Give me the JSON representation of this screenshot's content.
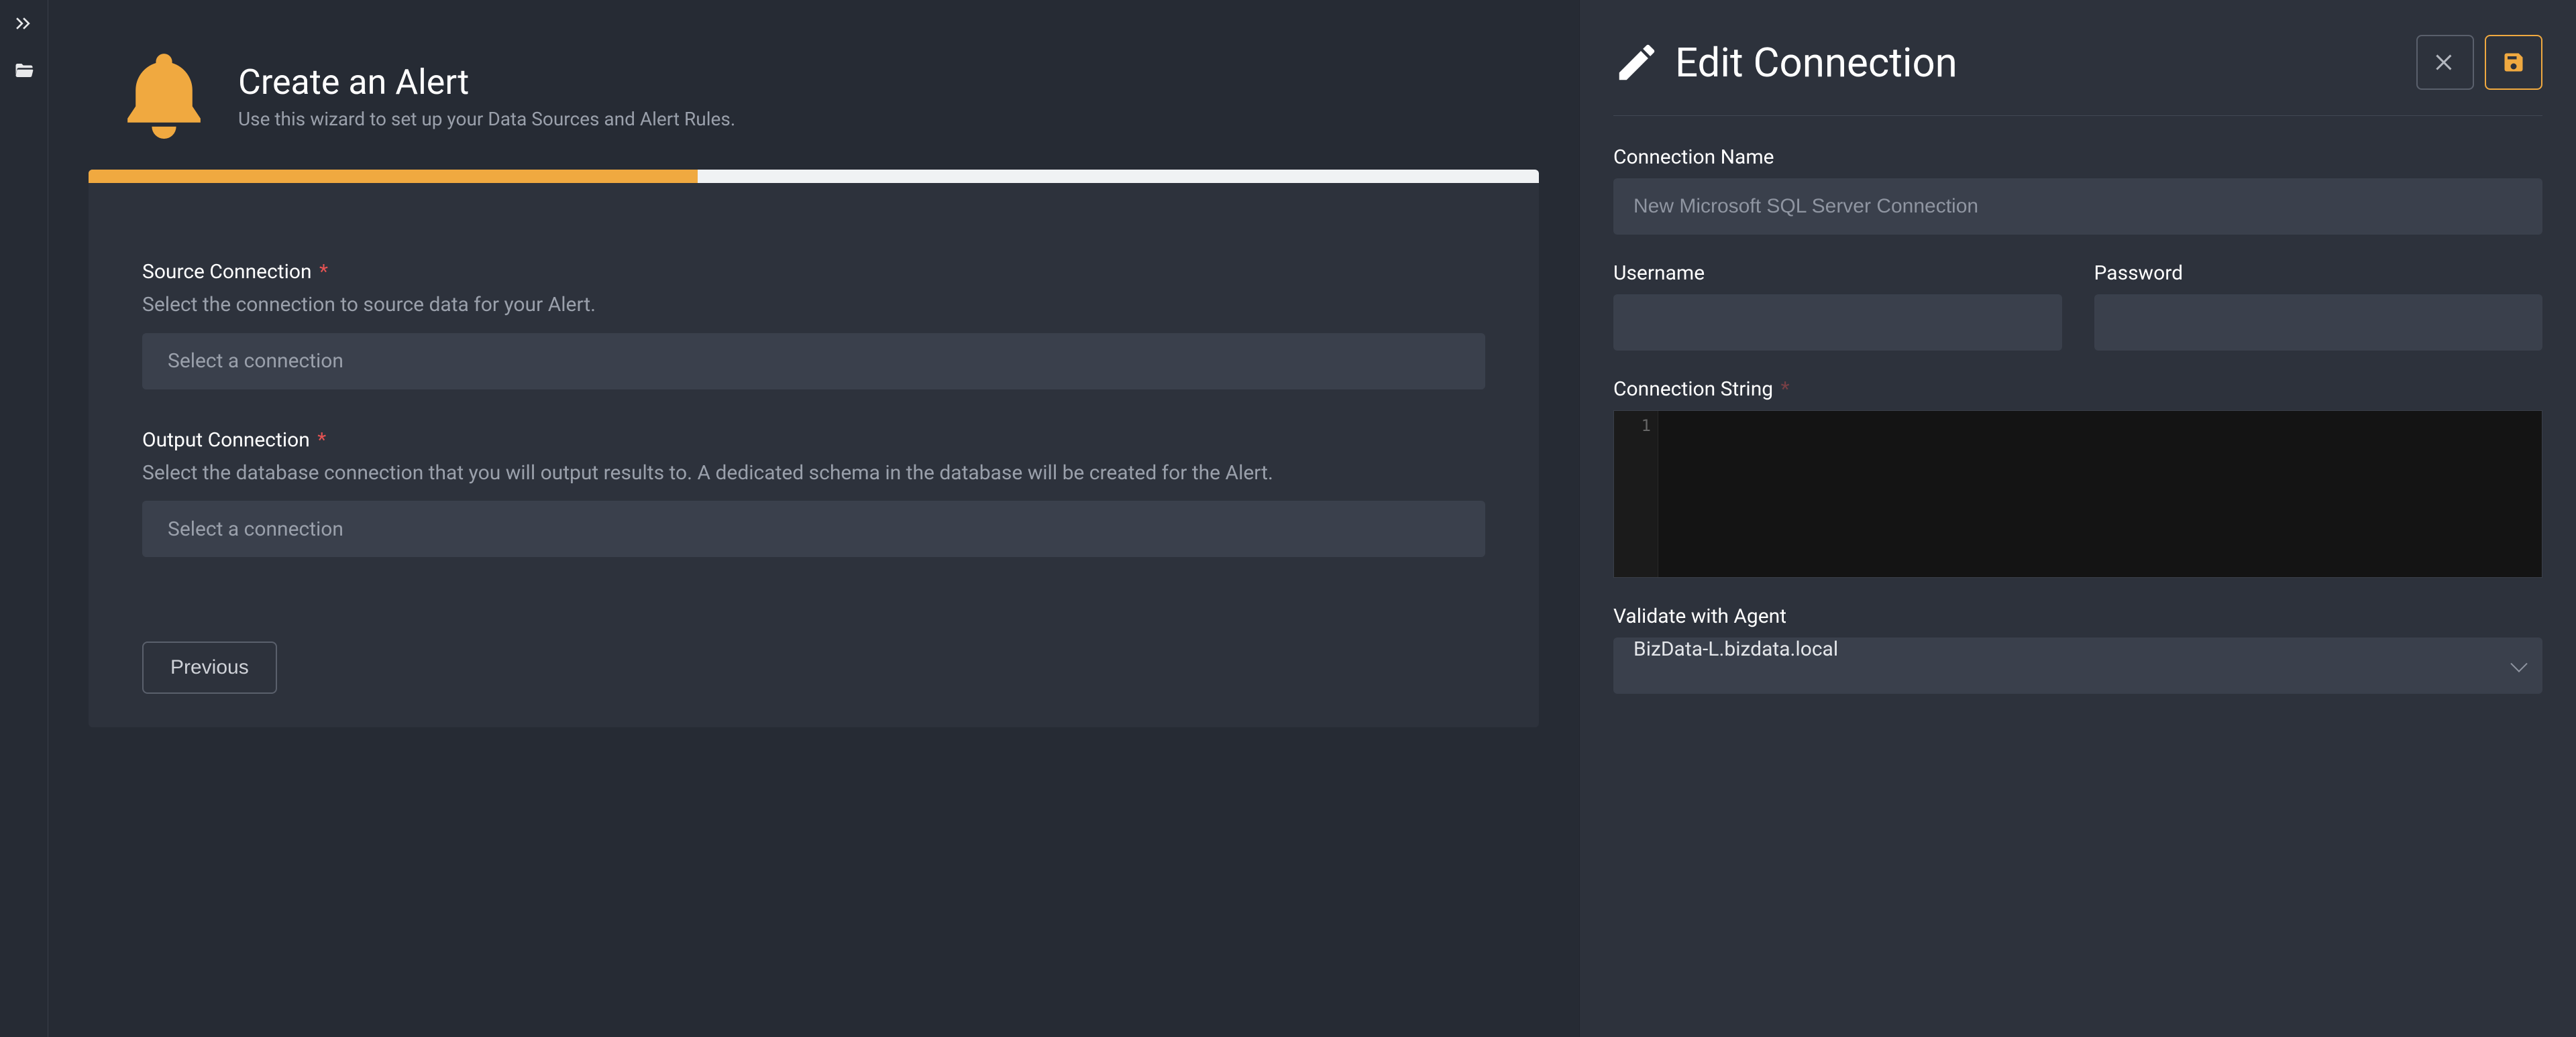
{
  "rail": {
    "expand_icon": "chevrons-right-icon",
    "folder_icon": "folder-open-icon"
  },
  "wizard": {
    "title": "Create an Alert",
    "subtitle": "Use this wizard to set up your Data Sources and Alert Rules.",
    "progress_percent": 42,
    "fields": {
      "source": {
        "label": "Source Connection",
        "required_marker": "*",
        "help": "Select the connection to source data for your Alert.",
        "placeholder": "Select a connection"
      },
      "output": {
        "label": "Output Connection",
        "required_marker": "*",
        "help": "Select the database connection that you will output results to. A dedicated schema in the database will be created for the Alert.",
        "placeholder": "Select a connection"
      }
    },
    "buttons": {
      "previous": "Previous"
    }
  },
  "panel": {
    "title": "Edit Connection",
    "fields": {
      "connection_name": {
        "label": "Connection Name",
        "placeholder": "New Microsoft SQL Server Connection",
        "value": ""
      },
      "username": {
        "label": "Username",
        "value": ""
      },
      "password": {
        "label": "Password",
        "value": ""
      },
      "connection_string": {
        "label": "Connection String",
        "required_marker": "*",
        "line_number": "1",
        "value": ""
      },
      "validate_agent": {
        "label": "Validate with Agent",
        "selected": "BizData-L.bizdata.local"
      }
    }
  }
}
